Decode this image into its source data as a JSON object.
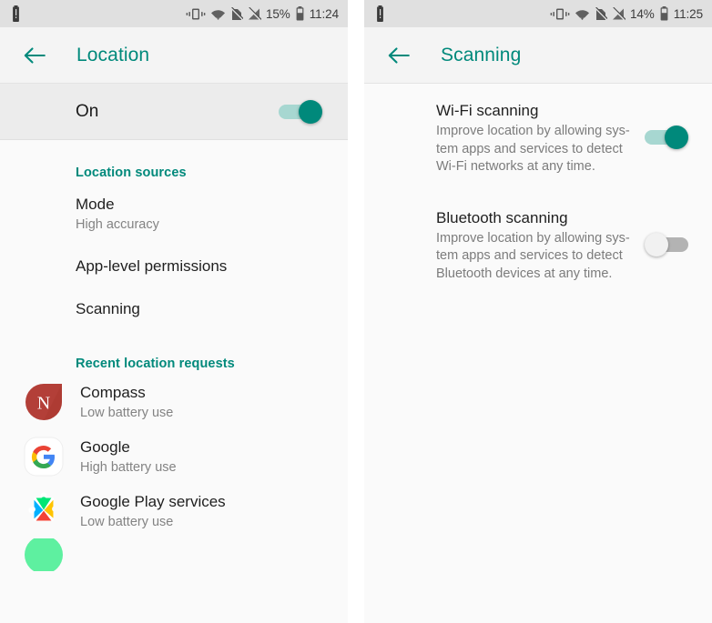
{
  "left": {
    "statusbar": {
      "battery_alert_icon": "battery-alert-icon",
      "vibrate_icon": "vibrate-icon",
      "wifi_icon": "wifi-icon",
      "sim_off_icon": "sim-off-icon",
      "signal_off_icon": "signal-off-icon",
      "battery_percent": "15%",
      "battery_icon": "battery-icon",
      "time": "11:24"
    },
    "toolbar": {
      "back_icon": "back-arrow-icon",
      "title": "Location"
    },
    "master_switch": {
      "label": "On",
      "state": "on"
    },
    "sections": {
      "sources_header": "Location sources",
      "requests_header": "Recent location requests"
    },
    "items": [
      {
        "title": "Mode",
        "subtitle": "High accuracy"
      },
      {
        "title": "App-level permissions",
        "subtitle": ""
      },
      {
        "title": "Scanning",
        "subtitle": ""
      }
    ],
    "apps": [
      {
        "name": "Compass",
        "battery": "Low battery use",
        "icon": "compass-app-icon"
      },
      {
        "name": "Google",
        "battery": "High battery use",
        "icon": "google-app-icon"
      },
      {
        "name": "Google Play services",
        "battery": "Low battery use",
        "icon": "google-play-services-icon"
      }
    ]
  },
  "right": {
    "statusbar": {
      "battery_percent": "14%",
      "time": "11:25"
    },
    "toolbar": {
      "back_icon": "back-arrow-icon",
      "title": "Scanning"
    },
    "rows": [
      {
        "title": "Wi-Fi scanning",
        "desc": "Improve location by allowing sys-\ntem apps and services to detect\nWi-Fi networks at any time.",
        "state": "on"
      },
      {
        "title": "Bluetooth scanning",
        "desc": "Improve location by allowing sys-\ntem apps and services to detect\nBluetooth devices at any time.",
        "state": "off"
      }
    ]
  },
  "colors": {
    "accent": "#00897b",
    "switch_on_track": "#a7d7d1",
    "switch_off_track": "#b3b3b3",
    "compass_red": "#b33f38"
  }
}
